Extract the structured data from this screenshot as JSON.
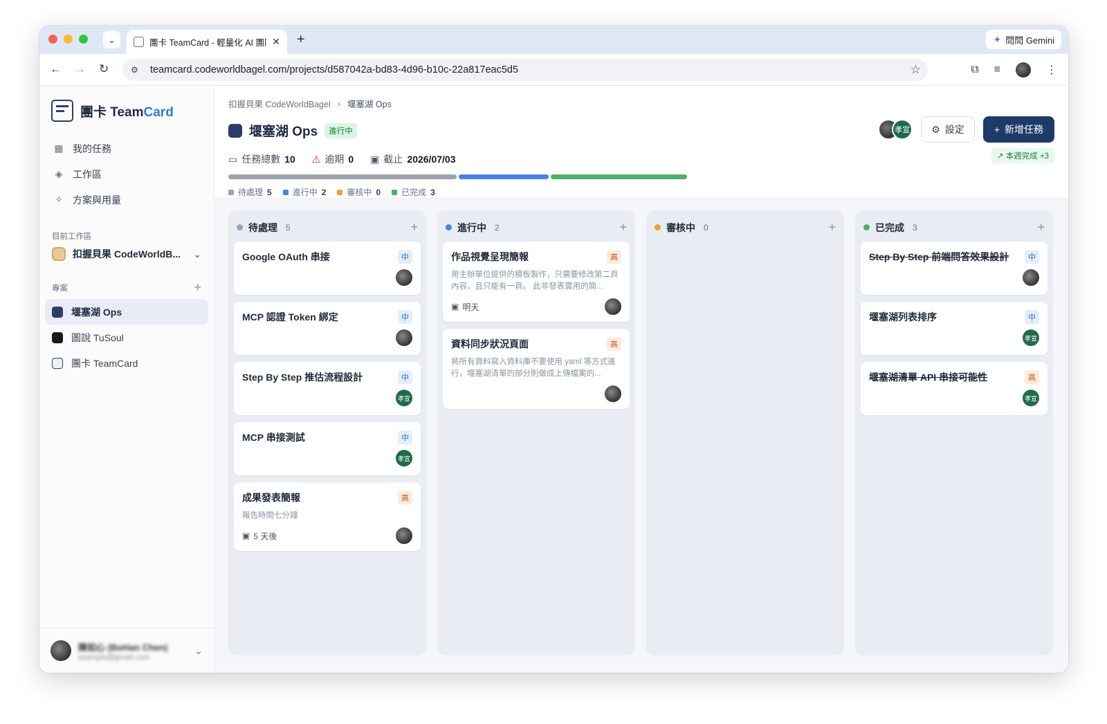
{
  "browser": {
    "tab_title": "團卡 TeamCard - 輕量化 AI 團隊",
    "url": "teamcard.codeworldbagel.com/projects/d587042a-bd83-4d96-b10c-22a817eac5d5",
    "gemini_label": "問問 Gemini"
  },
  "sidebar": {
    "brand_prefix": "團卡 Team",
    "brand_accent": "Card",
    "nav": [
      {
        "label": "我的任務",
        "icon": "grid-icon"
      },
      {
        "label": "工作區",
        "icon": "layers-icon"
      },
      {
        "label": "方案與用量",
        "icon": "sparkle-icon"
      }
    ],
    "workspace_section": "目前工作區",
    "workspace_name": "扣握貝果 CodeWorldB...",
    "projects_section": "專案",
    "projects": [
      {
        "label": "堰塞湖 Ops",
        "active": true
      },
      {
        "label": "圖說 TuSoul",
        "active": false
      },
      {
        "label": "團卡 TeamCard",
        "active": false
      }
    ],
    "user_name": "陳如心 (BoHan Chen)",
    "user_email": "example@gmail.com"
  },
  "header": {
    "breadcrumb_root": "扣握貝果 CodeWorldBagel",
    "breadcrumb_current": "堰塞湖 Ops",
    "title": "堰塞湖 Ops",
    "status": "進行中",
    "stats": {
      "total_label": "任務總數",
      "total_value": "10",
      "overdue_label": "逾期",
      "overdue_value": "0",
      "due_label": "截止",
      "due_value": "2026/07/03"
    },
    "progress": [
      {
        "label": "待處理",
        "count": "5",
        "fraction": 0.5,
        "color": "#9ca3af"
      },
      {
        "label": "進行中",
        "count": "2",
        "fraction": 0.2,
        "color": "#4f7fe0"
      },
      {
        "label": "審核中",
        "count": "0",
        "fraction": 0.0,
        "color": "#e8a23a"
      },
      {
        "label": "已完成",
        "count": "3",
        "fraction": 0.3,
        "color": "#4caf6e"
      }
    ],
    "settings_label": "設定",
    "new_task_label": "新增任務",
    "weekly_label": "本週完成 +3",
    "member_initials": "孝宣"
  },
  "columns": [
    {
      "title": "待處理",
      "count": "5",
      "color": "#9ca3af",
      "cards": [
        {
          "title": "Google OAuth 串接",
          "priority": "中",
          "level": "mid",
          "desc": "",
          "due": "",
          "avatar": "photo"
        },
        {
          "title": "MCP 認證 Token 綁定",
          "priority": "中",
          "level": "mid",
          "desc": "",
          "due": "",
          "avatar": "photo"
        },
        {
          "title": "Step By Step 推估流程設計",
          "priority": "中",
          "level": "mid",
          "desc": "",
          "due": "",
          "avatar": "green"
        },
        {
          "title": "MCP 串接測試",
          "priority": "中",
          "level": "mid",
          "desc": "",
          "due": "",
          "avatar": "green"
        },
        {
          "title": "成果發表簡報",
          "priority": "高",
          "level": "high",
          "desc": "報告時間七分鐘",
          "due": "5 天後",
          "avatar": "photo"
        }
      ]
    },
    {
      "title": "進行中",
      "count": "2",
      "color": "#4f7fe0",
      "cards": [
        {
          "title": "作品視覺呈現簡報",
          "priority": "高",
          "level": "high",
          "desc": "用主辦單位提供的模板製作，只需要修改第二頁內容，且只能有一頁。 此非發表實用的簡...",
          "due": "明天",
          "avatar": "photo"
        },
        {
          "title": "資料同步狀況頁面",
          "priority": "高",
          "level": "high",
          "desc": "將所有資料寫入資料庫不要使用 yaml 等方式進行，堰塞湖清單的部分則做成上傳檔案的...",
          "due": "",
          "avatar": "photo"
        }
      ]
    },
    {
      "title": "審核中",
      "count": "0",
      "color": "#e8a23a",
      "cards": []
    },
    {
      "title": "已完成",
      "count": "3",
      "color": "#4caf6e",
      "cards": [
        {
          "title": "Step By Step 前端問答效果設計",
          "priority": "中",
          "level": "mid",
          "desc": "",
          "due": "",
          "avatar": "photo",
          "done": true
        },
        {
          "title": "堰塞湖列表排序",
          "priority": "中",
          "level": "mid",
          "desc": "",
          "due": "",
          "avatar": "green",
          "done": false
        },
        {
          "title": "堰塞湖清單 API 串接可能性",
          "priority": "高",
          "level": "high",
          "desc": "",
          "due": "",
          "avatar": "green",
          "done": true
        }
      ]
    }
  ]
}
